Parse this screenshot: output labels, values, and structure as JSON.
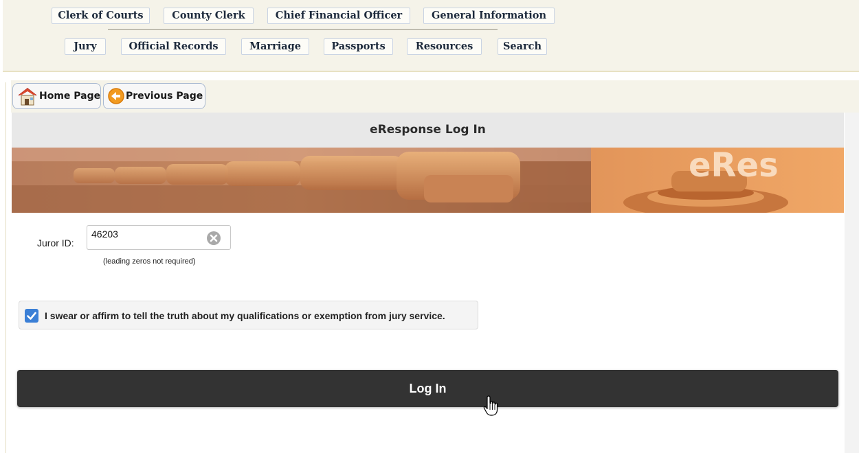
{
  "top_nav": {
    "row1": [
      "Clerk of Courts",
      "County Clerk",
      "Chief Financial Officer",
      "General Information"
    ],
    "row2": [
      "Jury",
      "Official Records",
      "Marriage",
      "Passports",
      "Resources",
      "Search"
    ]
  },
  "page_buttons": {
    "home": {
      "label": "Home Page",
      "icon": "house-icon"
    },
    "previous": {
      "label": "Previous Page",
      "icon": "back-arrow-icon"
    }
  },
  "login": {
    "header": "eResponse Log In",
    "banner_text": "eRes",
    "juror_label": "Juror ID:",
    "juror_value": "46203",
    "hint": "(leading zeros not required)",
    "oath_text": "I swear or affirm to tell the truth about my qualifications or exemption from jury service.",
    "oath_checked": true,
    "button_label": "Log In"
  },
  "colors": {
    "nav_bg": "#f5f3e9",
    "tab_border": "#c9d3e3",
    "header_bg": "#e8e8e8",
    "checkbox": "#3a7fd6",
    "login_button": "#333333"
  }
}
